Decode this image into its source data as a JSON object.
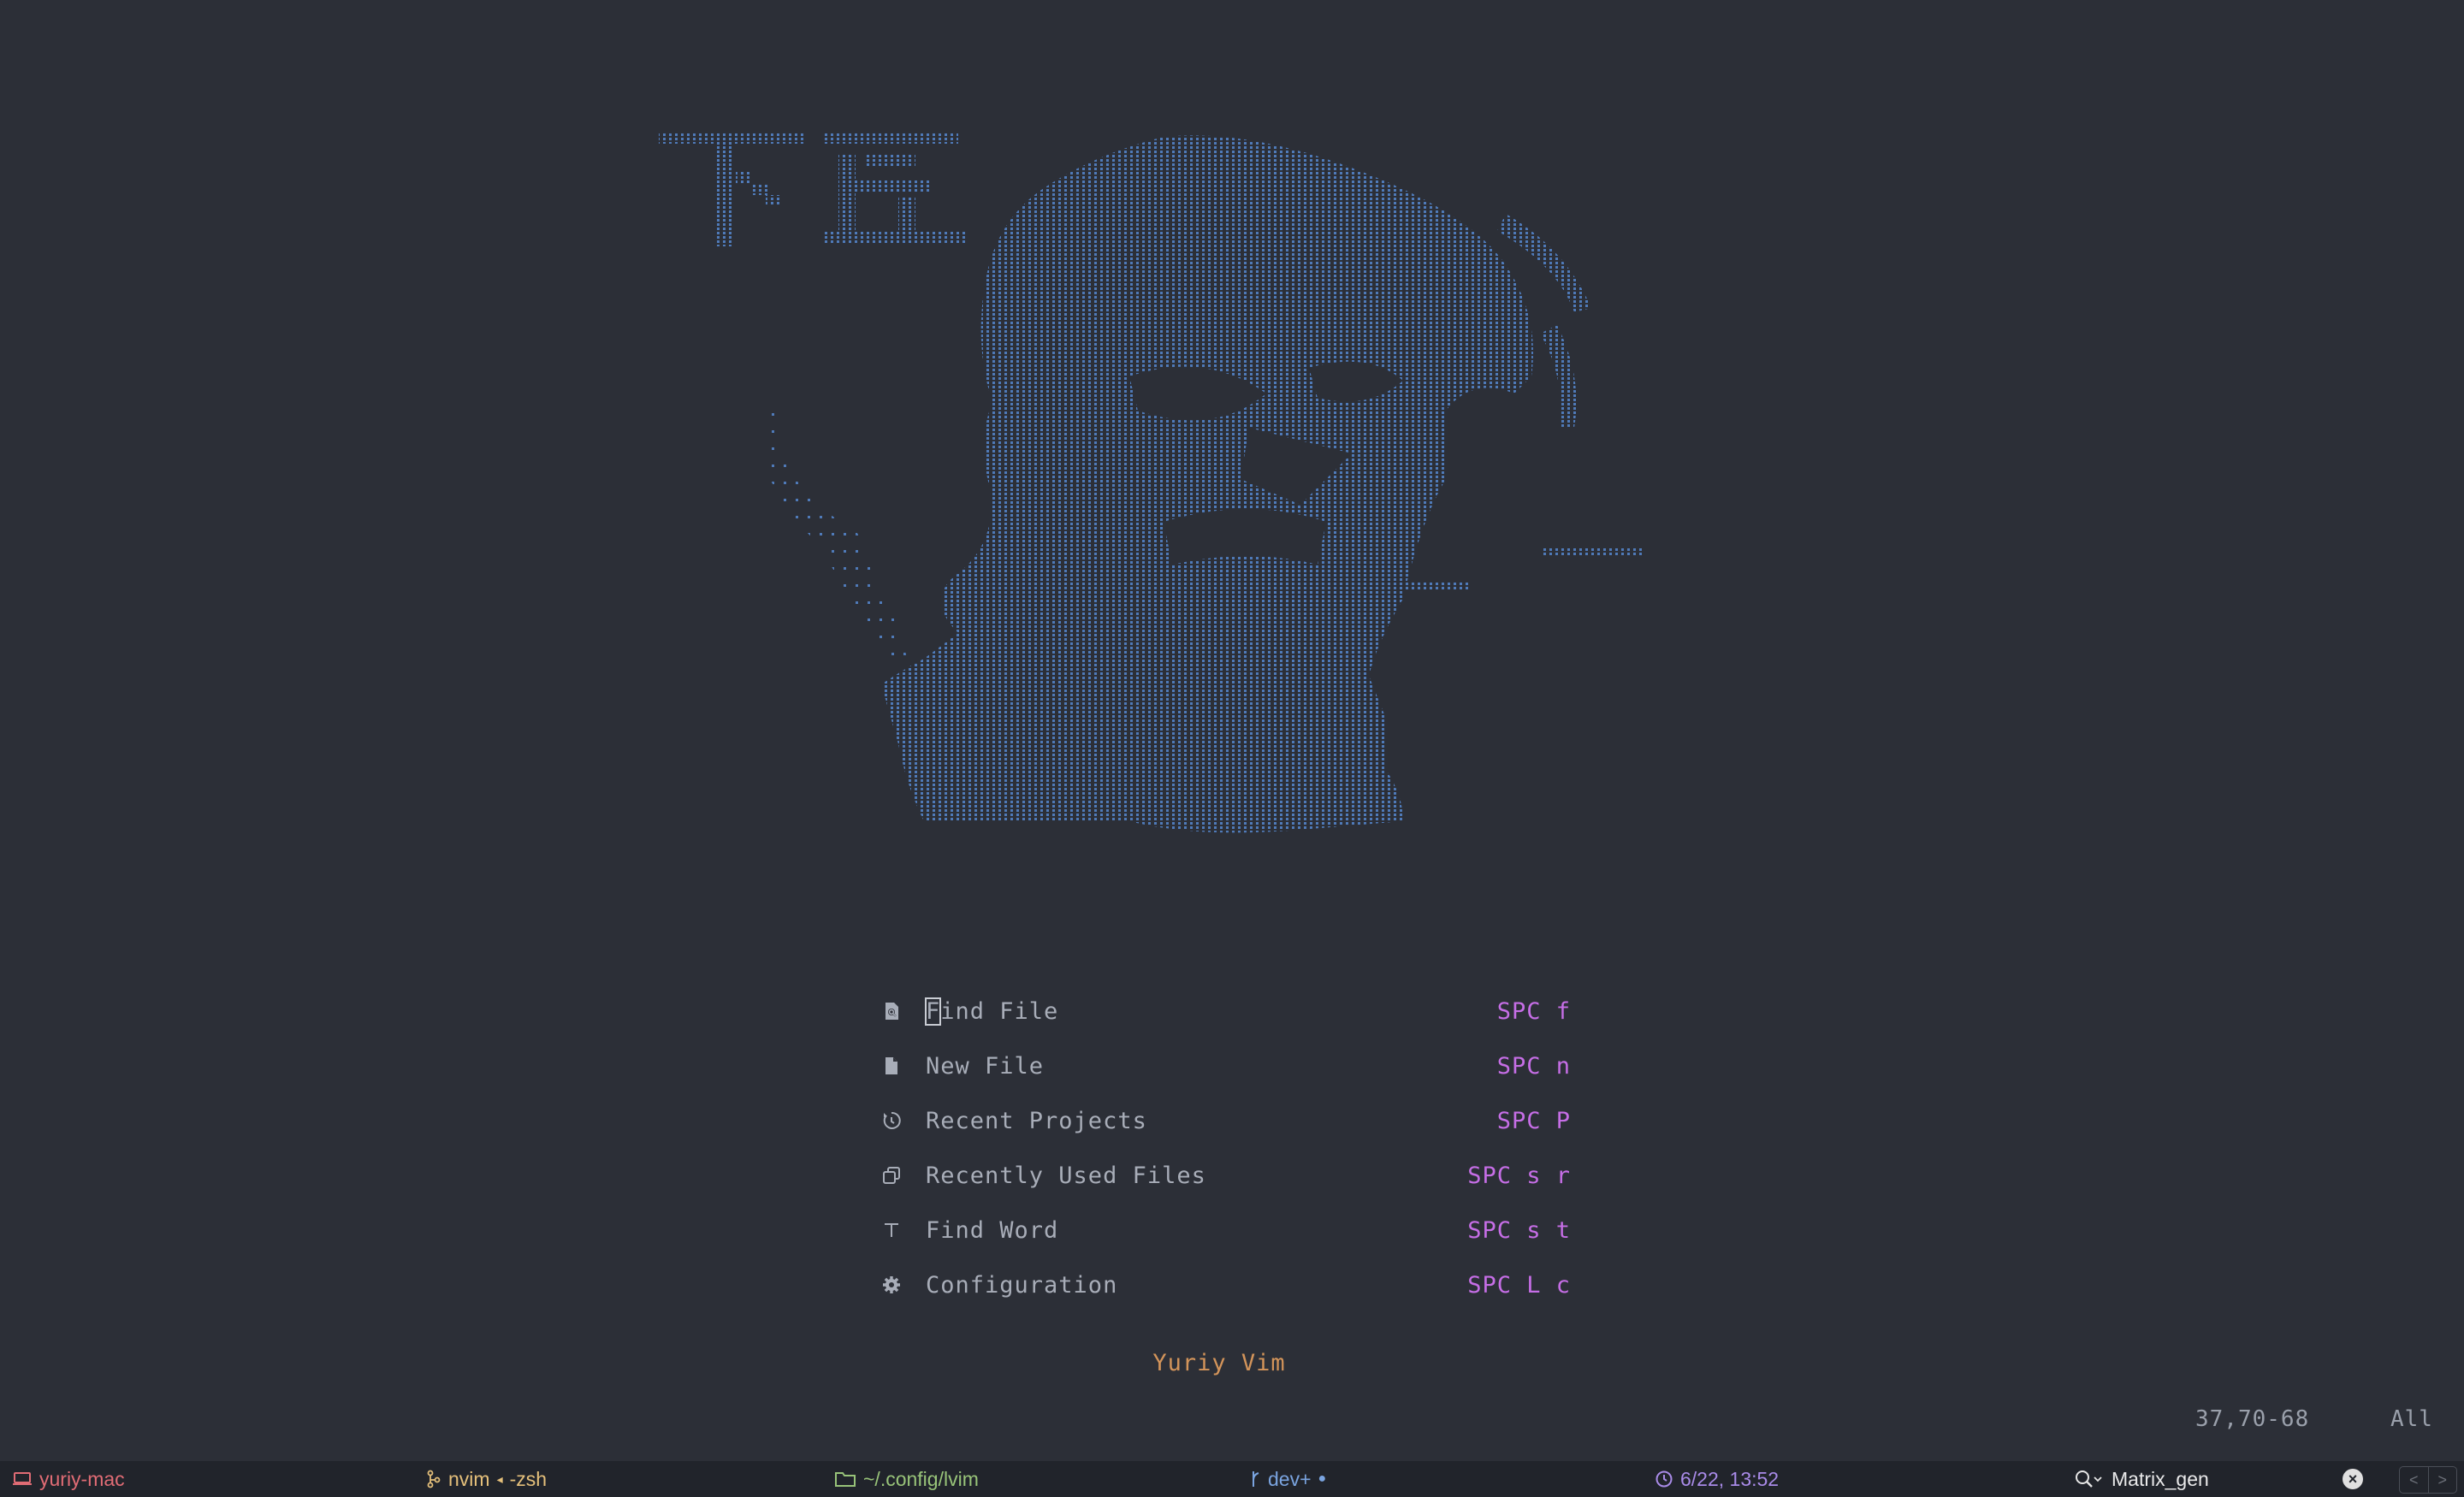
{
  "dashboard": {
    "menu": [
      {
        "label": "Find File",
        "label_rest": "ind File",
        "label_first": "F",
        "key": "SPC f",
        "icon": "search-file-icon"
      },
      {
        "label": "New File",
        "key": "SPC n",
        "icon": "file-icon"
      },
      {
        "label": "Recent Projects",
        "key": "SPC P",
        "icon": "history-icon"
      },
      {
        "label": "Recently Used Files",
        "key": "SPC s r",
        "icon": "copy-files-icon"
      },
      {
        "label": "Find Word",
        "key": "SPC s t",
        "icon": "text-icon"
      },
      {
        "label": "Configuration",
        "key": "SPC L c",
        "icon": "gear-icon"
      }
    ],
    "footer": "Yuriy Vim"
  },
  "ruler": {
    "position": "37,70-68",
    "scroll": "All"
  },
  "statusbar": {
    "host": "yuriy-mac",
    "process": "nvim",
    "process_sep": "◂",
    "shell": "-zsh",
    "directory": "~/.config/lvim",
    "branch": "dev+",
    "branch_dot": "●",
    "datetime": "6/22, 13:52",
    "search_value": "Matrix_gen",
    "clear": "×",
    "nav_back": "<",
    "nav_forward": ">"
  },
  "colors": {
    "background": "#2c2f37",
    "art": "#4f7ab8",
    "key": "#c66ee6",
    "footer": "#d3945a",
    "host": "#e06c75",
    "process": "#e5c07b",
    "directory": "#98c379",
    "branch": "#7aa4e0",
    "time": "#a98be8"
  }
}
